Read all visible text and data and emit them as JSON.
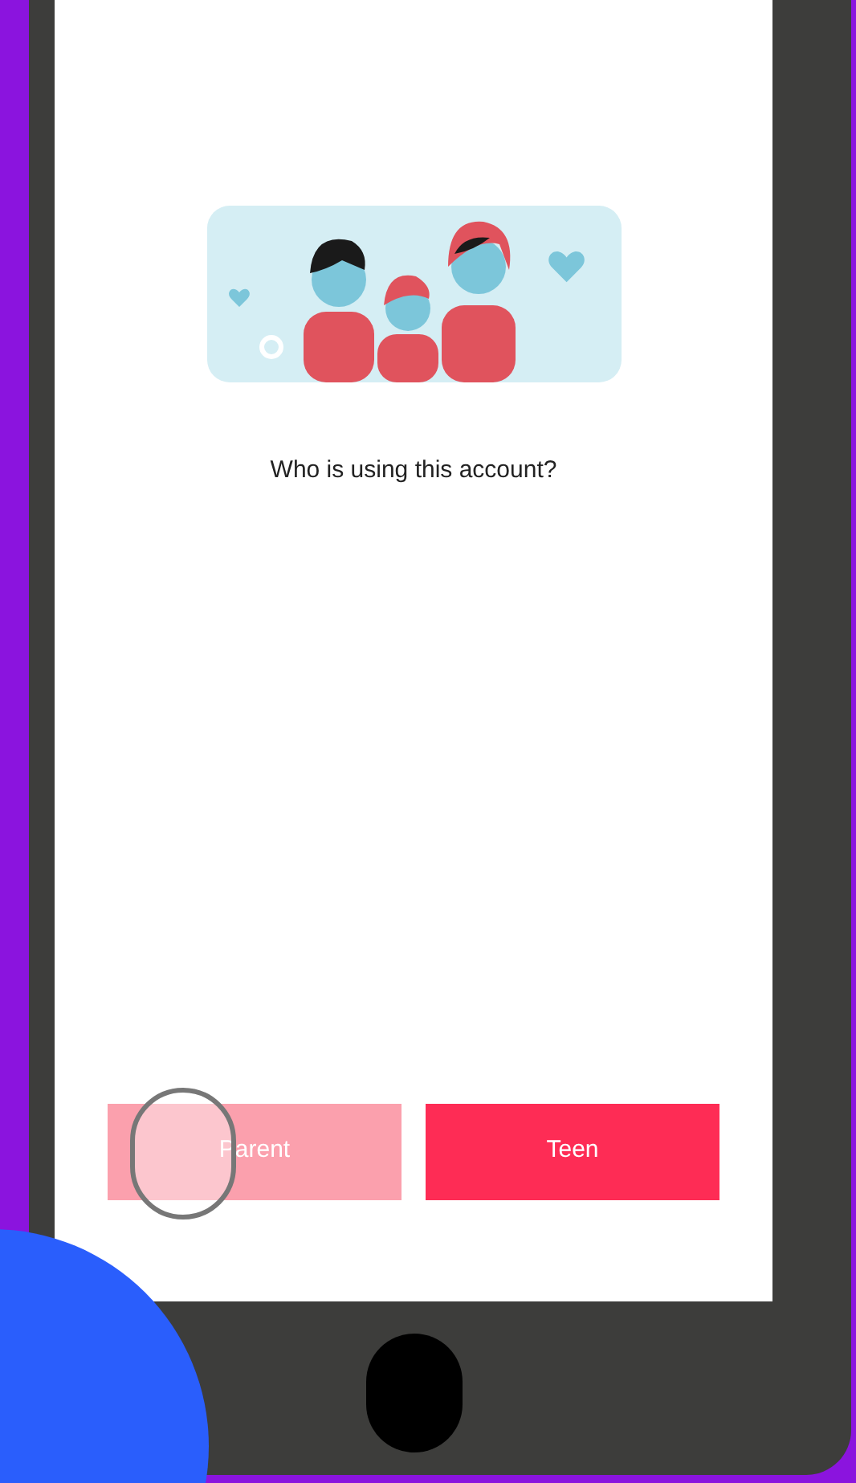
{
  "question": "Who is using this account?",
  "buttons": [
    {
      "label": "Parent",
      "pressed": true
    },
    {
      "label": "Teen",
      "pressed": false
    }
  ]
}
